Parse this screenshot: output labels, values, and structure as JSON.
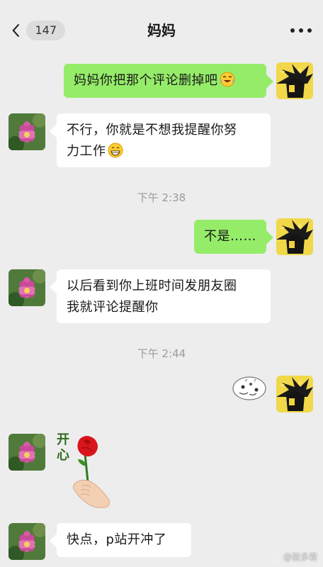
{
  "header": {
    "title": "妈妈",
    "unread_count": "147"
  },
  "messages": {
    "m1": "妈妈你把那个评论删掉吧",
    "m2_line1": "不行，你就是不想我提醒你努",
    "m2_line2": "力工作",
    "m3": "不是……",
    "m4_line1": "以后看到你上班时间发朋友圈",
    "m4_line2": "我就评论提醒你",
    "sticker_text": "开心",
    "m5": "快点，p站开冲了"
  },
  "timestamps": {
    "t1": "下午 2:38",
    "t2": "下午 2:44"
  },
  "watermark": "@鼠多君",
  "colors": {
    "background": "#ededed",
    "bubble_self": "#95ec69",
    "bubble_other": "#ffffff",
    "timestamp": "#9a9a9a"
  },
  "icons": {
    "back": "chevron-left-icon",
    "more": "more-dots-icon",
    "emoji_m1": "crying-laughing-emoji",
    "emoji_m2": "grinning-emoji"
  }
}
